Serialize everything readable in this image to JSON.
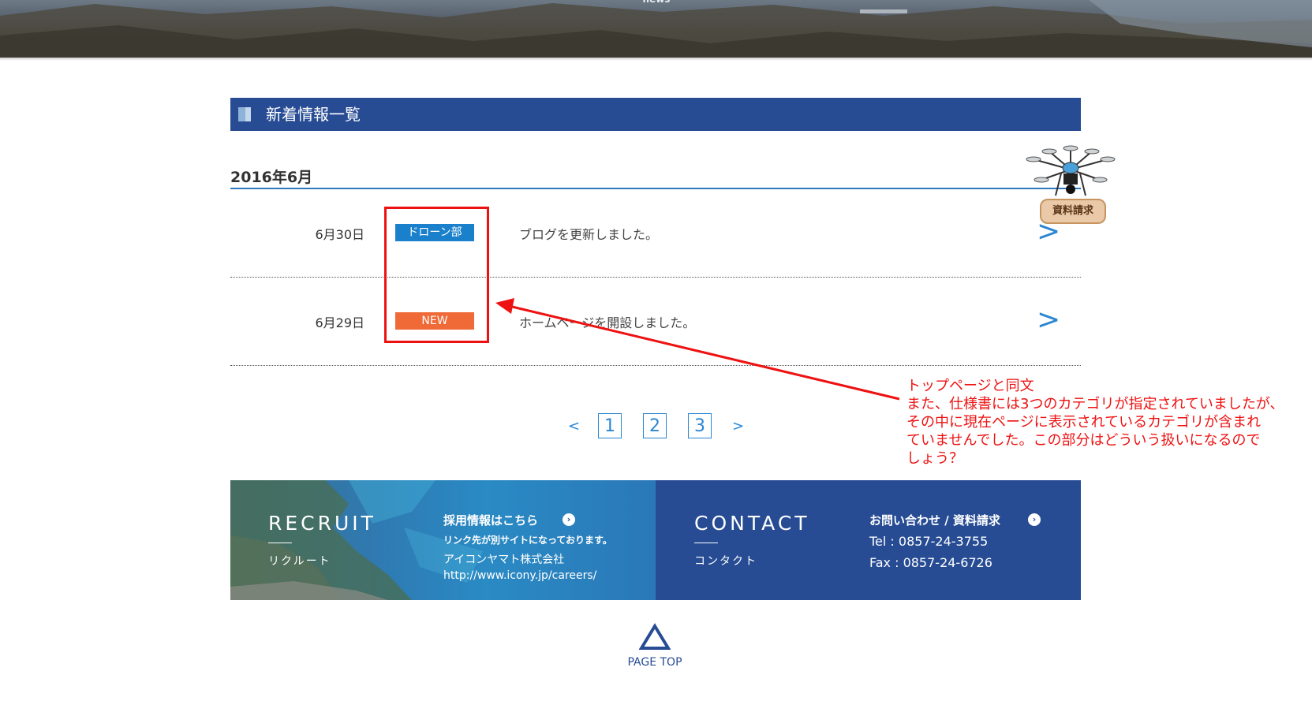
{
  "hero": {
    "label": "news"
  },
  "section": {
    "title": "新着情報一覧"
  },
  "month": "2016年6月",
  "news_items": [
    {
      "date": "6月30日",
      "category": "ドローン部",
      "category_color": "#1a80cc",
      "text": "ブログを更新しました。",
      "arrow": ">"
    },
    {
      "date": "6月29日",
      "category": "NEW",
      "category_color": "#ef6a37",
      "text": "ホームページを開設しました。",
      "arrow": ">"
    }
  ],
  "pagination": {
    "prev": "<",
    "pages": [
      "1",
      "2",
      "3"
    ],
    "next": ">"
  },
  "footer": {
    "recruit": {
      "title": "RECRUIT",
      "subtitle": "リクルート",
      "link_label": "採用情報はこちら",
      "note": "リンク先が別サイトになっております。",
      "company": "アイコンヤマト株式会社",
      "url": "http://www.icony.jp/careers/"
    },
    "contact": {
      "title": "CONTACT",
      "subtitle": "コンタクト",
      "link_label": "お問い合わせ / 資料請求",
      "tel": "Tel : 0857-24-3755",
      "fax": "Fax : 0857-24-6726"
    }
  },
  "page_top": {
    "label": "PAGE TOP"
  },
  "floating_button": {
    "label": "資料請求"
  },
  "annotation": {
    "lines": [
      "トップページと同文",
      "また、仕様書には3つのカテゴリが指定されていましたが、",
      "その中に現在ページに表示されているカテゴリが含まれ",
      "ていませんでした。この部分はどういう扱いになるので",
      "しょう？"
    ],
    "color": "#ee1111"
  },
  "colors": {
    "brand_blue": "#274c94",
    "accent_blue": "#2a86d2"
  }
}
